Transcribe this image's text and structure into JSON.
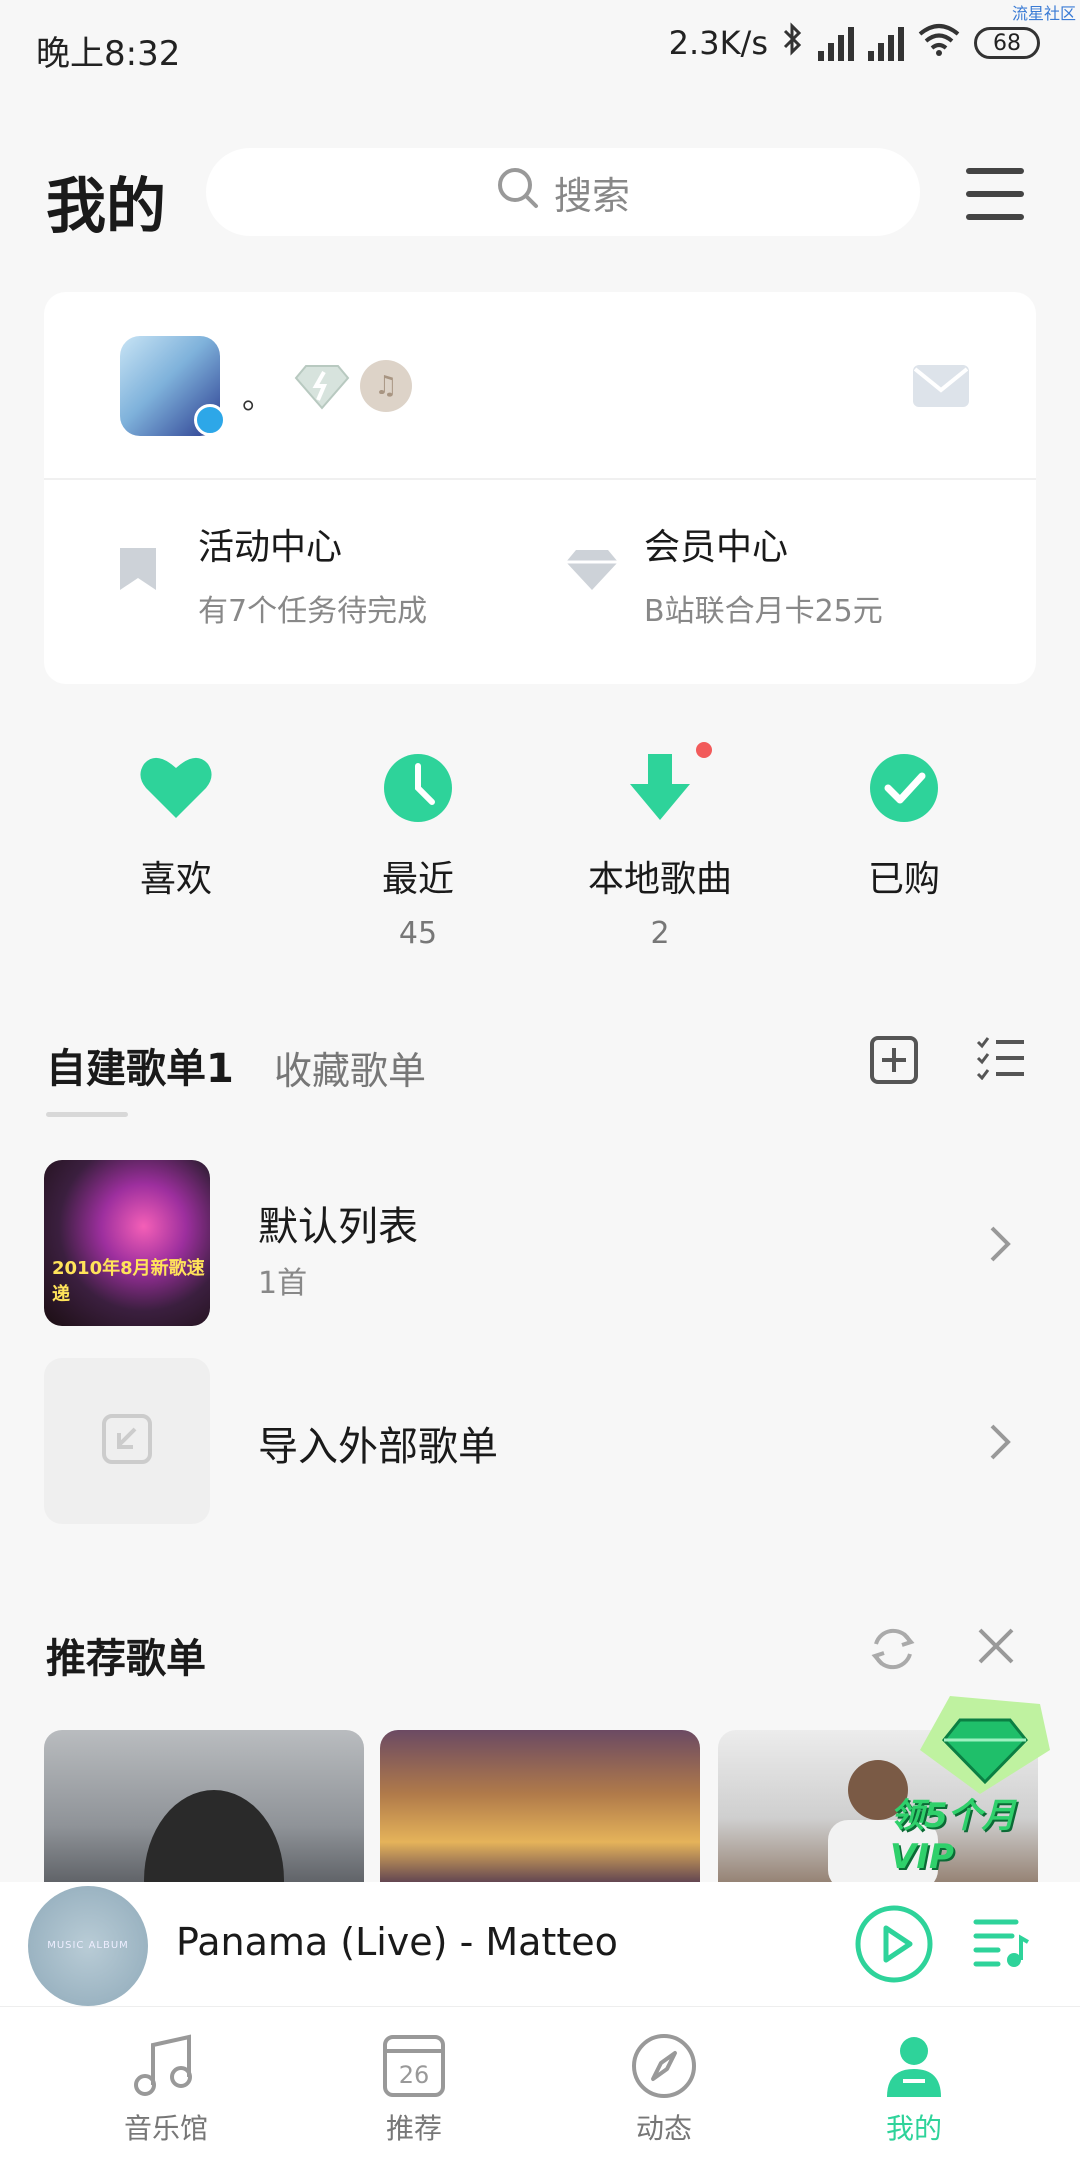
{
  "status_bar": {
    "time": "晚上8:32",
    "network_speed": "2.3K/s",
    "battery": "68",
    "watermark": "流星社区"
  },
  "header": {
    "title": "我的",
    "search_placeholder": "搜索"
  },
  "profile": {
    "username": "。",
    "activity": {
      "title": "活动中心",
      "subtitle": "有7个任务待完成"
    },
    "membership": {
      "title": "会员中心",
      "subtitle": "B站联合月卡25元"
    }
  },
  "quick_actions": [
    {
      "label": "喜欢",
      "count": ""
    },
    {
      "label": "最近",
      "count": "45"
    },
    {
      "label": "本地歌曲",
      "count": "2"
    },
    {
      "label": "已购",
      "count": ""
    }
  ],
  "playlist_tabs": {
    "created": "自建歌单1",
    "collected": "收藏歌单"
  },
  "playlists": [
    {
      "title": "默认列表",
      "subtitle": "1首",
      "cover_caption": "2010年8月新歌速递"
    },
    {
      "title": "导入外部歌单"
    }
  ],
  "recommended": {
    "title": "推荐歌单",
    "vip_promo": "领5个月VIP"
  },
  "player": {
    "song": "Panama (Live) - Matteo",
    "disc_caption": "MUSIC ALBUM"
  },
  "nav": [
    {
      "label": "音乐馆"
    },
    {
      "label": "推荐",
      "icon_text": "26"
    },
    {
      "label": "动态"
    },
    {
      "label": "我的"
    }
  ],
  "colors": {
    "accent": "#2ed39a",
    "background": "#f7f7f7",
    "notification_dot": "#f25b5b"
  }
}
